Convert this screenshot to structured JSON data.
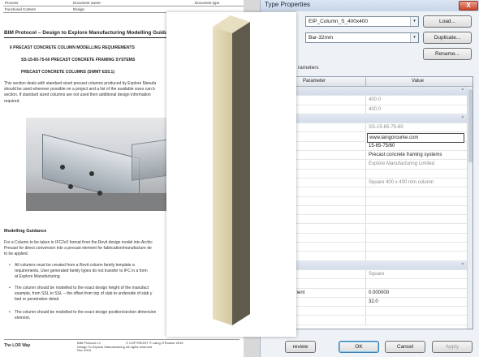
{
  "document": {
    "header": {
      "process": "Process",
      "document_owner": "Document owner",
      "document_type": "Document type",
      "functional_content": "Functional Content",
      "design": "Design"
    },
    "title": "BIM Protocol – Design to Explore Manufacturing Modelling Guidance",
    "section_a": "6     PRECAST CONCRETE COLUMN MODELLING REQUIREMENTS",
    "section_b": "SS-15-65-75-60 PRECAST CONCRETE FRAMING SYSTEMS",
    "section_c": "PRECAST CONCRETE COLUMNS (SWMT ES5.1)",
    "intro_lines": [
      "This section deals with standard sized precast columns produced by Explore Manufa",
      "should be used wherever possible on a project and a list of the available sizes can b",
      "section. If standard sized columns are not used then additional design information",
      "required."
    ],
    "modelling_title": "Modelling Guidance",
    "modelling_lines": [
      "For a Column to be taken in IFC2x3 format from the Revit design model into Archic",
      "Precast for direct conversion into a precast element for fabrication/manufacture de",
      "to be applied."
    ],
    "bullet_1": [
      "All columns must be created from a Revit column family template a",
      "requirements. User generated family types do not transfer to IFC in a form",
      "at Explore Manufacturing."
    ],
    "bullet_2": [
      "The column should be modelled to the exact design height of the manufact",
      "example, from SSL to SSL – the offset from top of slab to underside of slab y",
      "bed or penetration detail."
    ],
    "bullet_3": [
      "The column should be modelled to the exact design position/section dimension",
      "element."
    ],
    "bullet_char": "•",
    "footer": {
      "brand": "The LOR Way",
      "ref_lines": [
        "BIM Protocol v.1",
        "Design To Explore Manufacturing",
        "Rev 2015"
      ],
      "copyright_lines": [
        "© COPYRIGHT © Laing O'Rourke 2015",
        "All rights reserved"
      ]
    }
  },
  "dialog": {
    "title": "Type Properties",
    "close_glyph": "X",
    "family_value": "EIP_Column_S_400x400",
    "type_value": "Bar-32mm",
    "load_label": "Load...",
    "duplicate_label": "Duplicate...",
    "rename_label": "Rename...",
    "parameters_label": "rameters",
    "col_parameter": "Parameter",
    "col_value": "Value",
    "rows": [
      {
        "p": "nsions",
        "v": "",
        "kind": "group"
      },
      {
        "p": "",
        "v": "400.0",
        "kind": "grey"
      },
      {
        "p": "",
        "v": "400.0",
        "kind": "grey"
      },
      {
        "p": "ty Data",
        "v": "",
        "kind": "group"
      },
      {
        "p": "sReference",
        "v": "SS-15-65-75-60",
        "kind": "grey"
      },
      {
        "p": "",
        "v": "www.laingorourke.com",
        "kind": "boxed"
      },
      {
        "p": "eference",
        "v": "15-65-75/60",
        "kind": "normal"
      },
      {
        "p": "scription",
        "v": "Precast concrete framing systems",
        "kind": "normal"
      },
      {
        "p": "facturer",
        "v": "Explore Manufacturing Limited",
        "kind": "grey"
      },
      {
        "p": "le",
        "v": "",
        "kind": "normal"
      },
      {
        "p": "tion",
        "v": "Square 400 x 400 mm column",
        "kind": "grey"
      },
      {
        "p": "bly Code",
        "v": "",
        "kind": "normal"
      },
      {
        "p": "",
        "v": "",
        "kind": "normal"
      },
      {
        "p": "Comments",
        "v": "",
        "kind": "normal"
      },
      {
        "p": "bly Description",
        "v": "",
        "kind": "grey"
      },
      {
        "p": "Mark",
        "v": "",
        "kind": "normal"
      },
      {
        "p": "",
        "v": "",
        "kind": "normal"
      },
      {
        "p": "Class Number",
        "v": "",
        "kind": "grey"
      },
      {
        "p": "Class Title",
        "v": "",
        "kind": "grey"
      },
      {
        "p": "",
        "v": "",
        "kind": "group"
      },
      {
        "p": "",
        "v": "Square",
        "kind": "grey"
      },
      {
        "p": "nceData",
        "v": "",
        "kind": "normal"
      },
      {
        "p": "ityOfReinforcement",
        "v": "0.000000",
        "kind": "normal"
      },
      {
        "p": "teDiameter",
        "v": "32.0",
        "kind": "normal"
      },
      {
        "p": "reteGrade",
        "v": "",
        "kind": "normal"
      },
      {
        "p": "ionalItems",
        "v": "",
        "kind": "normal"
      }
    ],
    "preview_label": "review",
    "ok_label": "OK",
    "cancel_label": "Cancel",
    "apply_label": "Apply",
    "chevron_up": "⌃",
    "chevron_down": "▾"
  },
  "colors": {
    "column_front": "#d4c7a0",
    "column_side": "#5f5a4c",
    "column_top": "#e8dfc0"
  }
}
